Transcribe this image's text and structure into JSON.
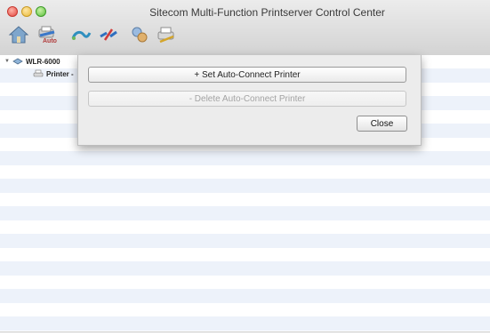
{
  "window": {
    "title": "Sitecom Multi-Function Printserver Control Center"
  },
  "toolbar": {
    "icons": [
      "home-icon",
      "auto-connect-icon",
      "connect-icon",
      "disconnect-icon",
      "settings-icon",
      "printer-tool-icon"
    ],
    "auto_badge": "Auto"
  },
  "tree": {
    "device_label": "WLR-6000",
    "printer_label": "Printer -"
  },
  "sheet": {
    "set_label": "+ Set Auto-Connect Printer",
    "delete_label": "- Delete Auto-Connect Printer",
    "close_label": "Close"
  },
  "colors": {
    "stripe": "#edf2fa",
    "sheet_bg": "#ececec"
  }
}
